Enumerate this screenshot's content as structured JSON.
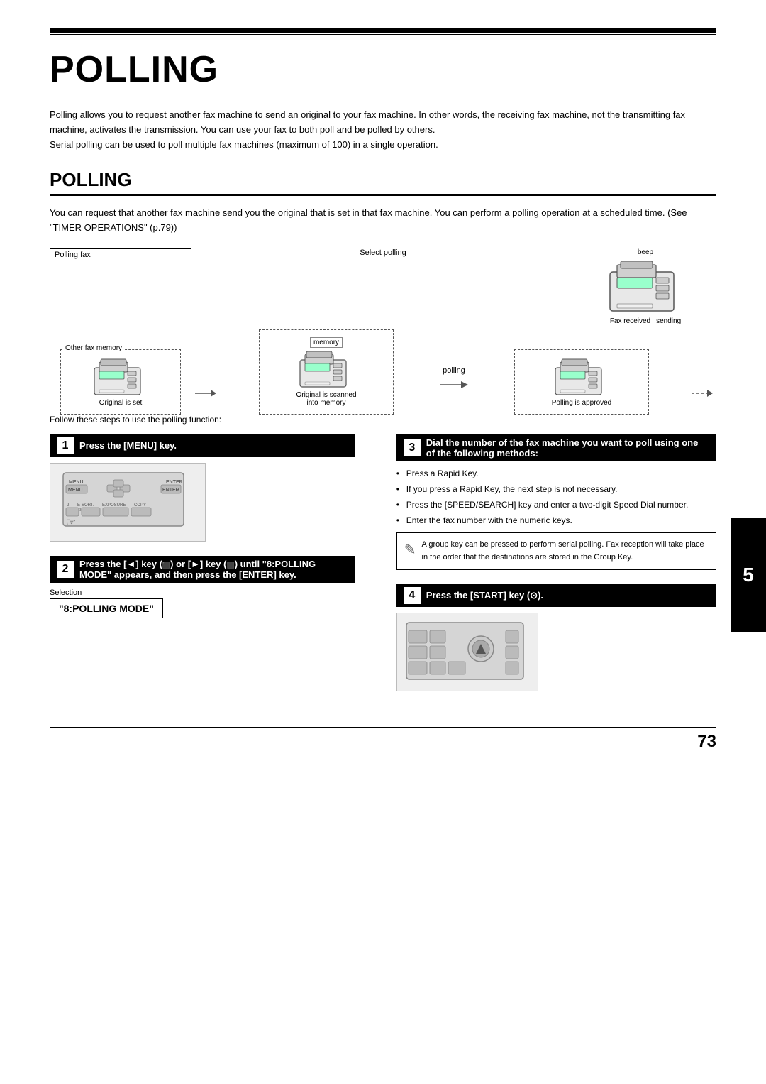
{
  "page": {
    "top_title": "POLLING",
    "intro_lines": [
      "Polling allows you to request another fax machine to send an original to your fax machine. In other words, the receiving fax machine, not the transmitting fax machine, activates the transmission. You can use your fax to both poll and be polled by others.",
      "Serial polling can be used to poll multiple fax machines (maximum of 100) in a single operation."
    ],
    "section_title": "POLLING",
    "section_desc": "You can request that another fax machine send you the original that is set in that fax machine. You can perform a polling operation at a scheduled time. (See \"TIMER OPERATIONS\" (p.79))",
    "diagram": {
      "polling_fax_label": "Polling fax",
      "other_fax_memory_label": "Other fax memory",
      "original_is_set": "Original is set",
      "memory_label": "memory",
      "original_is_scanned": "Original is scanned",
      "into_memory": "into memory",
      "select_polling_label": "Select polling",
      "polling_label": "polling",
      "polling_is_approved": "Polling is approved",
      "beep_label": "beep",
      "fax_received_label": "Fax received",
      "sending_label": "sending"
    },
    "follow_steps": "Follow these steps to use the polling function:",
    "step1": {
      "number": "1",
      "title": "Press the [MENU] key."
    },
    "step2": {
      "number": "2",
      "title": "Press the [◄] key (⬛) or [►] key (⬛) until \"8:POLLING MODE\" appears, and then press the [ENTER] key.",
      "selection_label": "Selection",
      "display_value": "\"8:POLLING MODE\""
    },
    "step3": {
      "number": "3",
      "title": "Dial the number of the fax machine you want to poll using one of the following methods:",
      "bullets": [
        "Press a Rapid Key.",
        "If you press a Rapid Key, the next step is not necessary.",
        "Press the [SPEED/SEARCH] key and enter a two-digit Speed Dial number.",
        "Enter the fax number with the numeric keys."
      ]
    },
    "step4": {
      "number": "4",
      "title": "Press the  [START] key (⊙)."
    },
    "note": {
      "text": "A group key can be pressed to perform serial polling. Fax reception will take place in the order that the destinations are stored in the Group Key."
    },
    "page_number": "73"
  }
}
